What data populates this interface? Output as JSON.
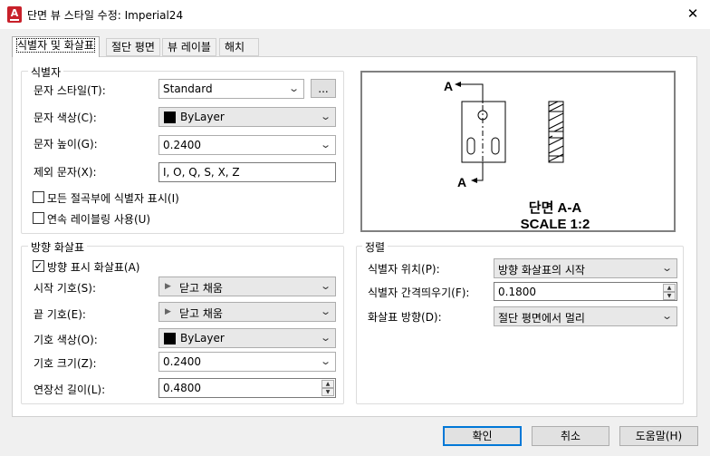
{
  "window": {
    "title": "단면 뷰 스타일 수정: Imperial24",
    "app_icon_letter": "A",
    "close": "✕"
  },
  "tabs": [
    {
      "label": "식별자 및 화살표",
      "active": true
    },
    {
      "label": "절단 평면",
      "active": false
    },
    {
      "label": "뷰 레이블",
      "active": false
    },
    {
      "label": "해치",
      "active": false
    }
  ],
  "identifier": {
    "title": "식별자",
    "text_style_label": "문자 스타일(T):",
    "text_style_value": "Standard",
    "browse_label": "...",
    "text_color_label": "문자 색상(C):",
    "text_color_value": "ByLayer",
    "text_height_label": "문자 높이(G):",
    "text_height_value": "0.2400",
    "exclude_label": "제외 문자(X):",
    "exclude_value": "I, O, Q, S, X, Z",
    "show_all_label": "모든 절곡부에 식별자 표시(I)",
    "show_all_checked": false,
    "continuous_label": "연속 레이블링 사용(U)",
    "continuous_checked": false
  },
  "arrows": {
    "title": "방향 화살표",
    "show_arrows_label": "방향 표시 화살표(A)",
    "show_arrows_checked": true,
    "start_symbol_label": "시작 기호(S):",
    "start_symbol_value": "닫고 채움",
    "end_symbol_label": "끝 기호(E):",
    "end_symbol_value": "닫고 채움",
    "symbol_color_label": "기호 색상(O):",
    "symbol_color_value": "ByLayer",
    "symbol_size_label": "기호 크기(Z):",
    "symbol_size_value": "0.2400",
    "extension_label": "연장선 길이(L):",
    "extension_value": "0.4800"
  },
  "preview": {
    "label_a": "A",
    "section_title": "단면 A-A",
    "scale_text": "SCALE 1:2"
  },
  "alignment": {
    "title": "정렬",
    "id_position_label": "식별자 위치(P):",
    "id_position_value": "방향 화살표의 시작",
    "id_offset_label": "식별자 간격띄우기(F):",
    "id_offset_value": "0.1800",
    "arrow_dir_label": "화살표 방향(D):",
    "arrow_dir_value": "절단 평면에서 멀리"
  },
  "buttons": {
    "ok": "확인",
    "cancel": "취소",
    "help": "도움말(H)"
  },
  "colors": {
    "accent": "#0078d7",
    "app_icon": "#c8202a"
  }
}
